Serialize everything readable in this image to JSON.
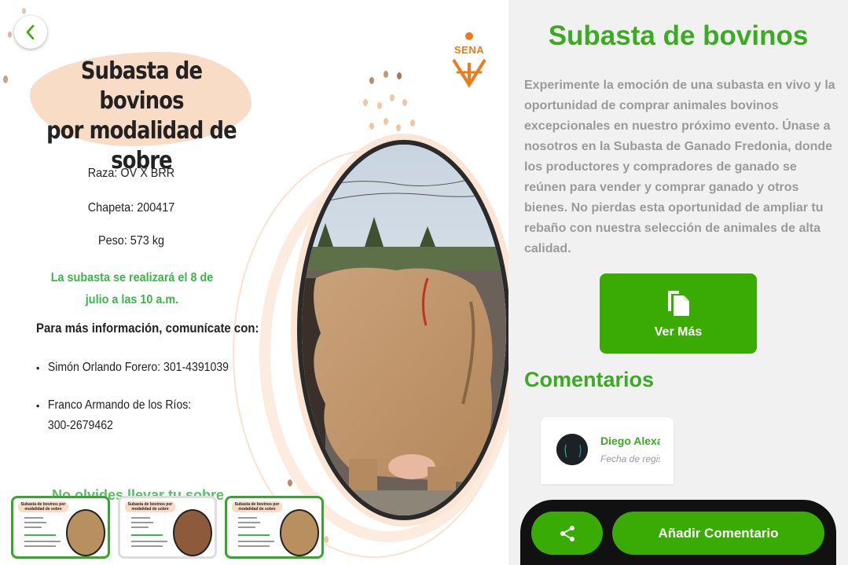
{
  "poster": {
    "title_line1": "Subasta de bovinos",
    "title_line2": "por modalidad de sobre",
    "logo_text": "SENA",
    "raza": "Raza: OV X BRR",
    "chapeta": "Chapeta: 200417",
    "peso": "Peso: 573 kg",
    "auction_note": "La subasta se realizará el 8 de julio a las 10 a.m.",
    "contact_heading": "Para más información, comunícate con:",
    "contacts": [
      "Simón Orlando Forero: 301-4391039",
      "Franco Armando de los Ríos: 300-2679462"
    ],
    "peek_text": "No olvides llevar tu sobre",
    "back_icon": "chevron-left-icon"
  },
  "thumbnails": [
    {
      "title": "Subasta de bovinos por modalidad de sobre",
      "selected": true
    },
    {
      "title": "Subasta de bovinos por modalidad de sobre",
      "selected": false
    },
    {
      "title": "Subasta de bovinos por modalidad de sobre",
      "selected": true
    }
  ],
  "panel": {
    "title": "Subasta de bovinos",
    "description": "Experimente la emoción de una subasta en vivo y la oportunidad de comprar animales bovinos excepcionales en nuestro próximo evento. Únase a nosotros en la Subasta de Ganado Fredonia, donde los productores y compradores de ganado se reúnen para vender y comprar ganado y otros bienes. No pierdas esta oportunidad de ampliar tu rebaño con nuestra selección de animales de alta calidad.",
    "ver_mas_label": "Ver Más",
    "ver_mas_icon": "document-copy-icon",
    "comments_title": "Comentarios",
    "comments": [
      {
        "name": "Diego Alexander",
        "date": "Fecha de registro"
      }
    ],
    "share_icon": "share-icon",
    "add_comment_label": "Añadir Comentario"
  },
  "colors": {
    "accent": "#3aab05",
    "title_green": "#3aab22",
    "poster_green": "#3bb54a",
    "sena_orange": "#f07a1a",
    "peach": "#f8dcc5"
  }
}
